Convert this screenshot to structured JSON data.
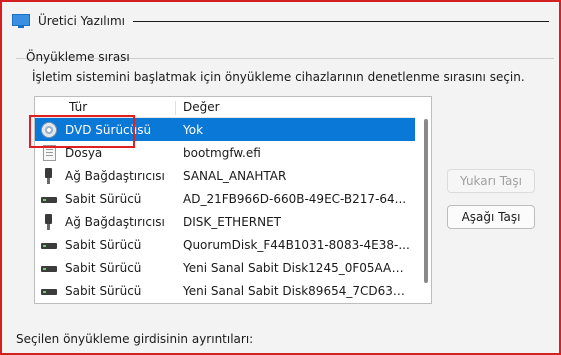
{
  "header": {
    "title": "Üretici Yazılımı",
    "icon": "monitor-icon"
  },
  "boot_order": {
    "group_label": "Önyükleme sırası",
    "description": "İşletim sistemini başlatmak için önyükleme cihazlarının denetlenme sırasını seçin.",
    "columns": {
      "type": "Tür",
      "value": "Değer"
    },
    "rows": [
      {
        "type": "DVD Sürücüsü",
        "value": "Yok",
        "icon": "dvd-icon",
        "selected": true
      },
      {
        "type": "Dosya",
        "value": "bootmgfw.efi",
        "icon": "file-icon"
      },
      {
        "type": "Ağ Bağdaştırıcısı",
        "value": "SANAL_ANAHTAR",
        "icon": "network-adapter-icon"
      },
      {
        "type": "Sabit Sürücü",
        "value": "AD_21FB966D-660B-49EC-B217-64...",
        "icon": "hard-drive-icon"
      },
      {
        "type": "Ağ Bağdaştırıcısı",
        "value": "DISK_ETHERNET",
        "icon": "network-adapter-icon"
      },
      {
        "type": "Sabit Sürücü",
        "value": "QuorumDisk_F44B1031-8083-4E38-...",
        "icon": "hard-drive-icon"
      },
      {
        "type": "Sabit Sürücü",
        "value": "Yeni Sanal Sabit Disk1245_0F05AAA...",
        "icon": "hard-drive-icon"
      },
      {
        "type": "Sabit Sürücü",
        "value": "Yeni Sanal Sabit Disk89654_7CD637...",
        "icon": "hard-drive-icon"
      }
    ],
    "buttons": {
      "move_up": "Yukarı Taşı",
      "move_down": "Aşağı Taşı"
    }
  },
  "details": {
    "label": "Seçilen önyükleme girdisinin ayrıntıları:"
  },
  "colors": {
    "selection": "#0a78d7",
    "highlight_box": "#e02020",
    "frame_border": "#d42020"
  }
}
